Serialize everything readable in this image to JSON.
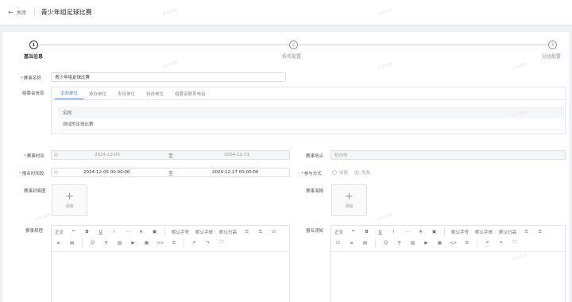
{
  "header": {
    "back_label": "关闭",
    "title": "青少年组足球比赛"
  },
  "steps": [
    {
      "num": "1",
      "label": "基础信息",
      "active": true
    },
    {
      "num": "2",
      "label": "报名配置",
      "active": false
    },
    {
      "num": "3",
      "label": "分组配置",
      "active": false
    }
  ],
  "form": {
    "name_label": "赛事名称",
    "name_value": "青少年组足球比赛",
    "org_label": "组委会信息",
    "org_tabs": [
      "主办单位",
      "承办单位",
      "支持单位",
      "协办单位",
      "组委会联系电话"
    ],
    "org_table": {
      "header": "名称",
      "rows": [
        "测试的足球比赛"
      ]
    },
    "time_label": "赛事时间",
    "time_start": "2024-12-05",
    "time_end": "2024-12-31",
    "range_sep": "至",
    "location_label": "赛事地点",
    "location_value": "杭州市",
    "signup_label": "报名时间段",
    "signup_start": "2024-12-05 00:00:00",
    "signup_end": "2024-12-27 00:00:00",
    "mode_label": "参与方式",
    "mode_options": [
      "收费",
      "免费"
    ],
    "mode_selected": "免费",
    "cover_label": "赛事封面图",
    "poster_label": "赛事海报",
    "upload_add": "添加",
    "rules_label": "赛事规程",
    "notice_label": "报名须知"
  },
  "editor_toolbar": {
    "row1": [
      "正文",
      "❝",
      "B",
      "U",
      "I",
      "···",
      "A",
      "▣",
      "默认字号",
      "默认字体",
      "默认行高"
    ],
    "row2": [
      "☰",
      "☰",
      "☑",
      "≡",
      "▤",
      "☺",
      "⚲",
      "▨",
      "▶",
      "▦",
      "<>",
      "☰",
      "↶",
      "↷"
    ],
    "row3": [
      "⛶"
    ]
  },
  "watermark": "天天运动"
}
